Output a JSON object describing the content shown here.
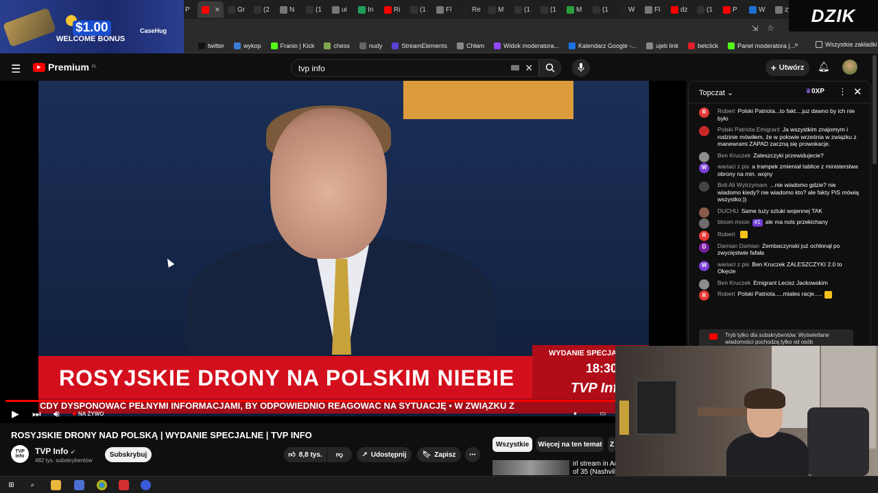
{
  "browser": {
    "tabs": [
      {
        "label": "",
        "color": "#ff0000"
      },
      {
        "label": "La",
        "color": "#ff0000"
      },
      {
        "label": "",
        "color": "#ff0000"
      },
      {
        "label": "",
        "color": "#ff0000"
      },
      {
        "label": "P",
        "color": "#ff0000"
      },
      {
        "label": "(3",
        "color": "#111111"
      },
      {
        "label": "P",
        "color": "#ff0000"
      },
      {
        "label": "",
        "color": "#ff0000"
      },
      {
        "label": "Gr",
        "color": "#333333"
      },
      {
        "label": "(2",
        "color": "#333333"
      },
      {
        "label": "N",
        "color": "#777777"
      },
      {
        "label": "(1",
        "color": "#333333"
      },
      {
        "label": "ui",
        "color": "#777777"
      },
      {
        "label": "In",
        "color": "#1e9e5a"
      },
      {
        "label": "Ri",
        "color": "#ff0000"
      },
      {
        "label": "(1",
        "color": "#333333"
      },
      {
        "label": "Fl",
        "color": "#777777"
      },
      {
        "label": "Re",
        "color": "#222222"
      },
      {
        "label": "M",
        "color": "#333333"
      },
      {
        "label": "(1",
        "color": "#333333"
      },
      {
        "label": "(1",
        "color": "#333333"
      },
      {
        "label": "M",
        "color": "#2e9e3e"
      },
      {
        "label": "(1",
        "color": "#333333"
      },
      {
        "label": "W",
        "color": "#222222"
      },
      {
        "label": "Fl",
        "color": "#777777"
      },
      {
        "label": "dz",
        "color": "#ff0000"
      },
      {
        "label": "(1",
        "color": "#333333"
      },
      {
        "label": "P",
        "color": "#ff0000"
      },
      {
        "label": "W",
        "color": "#1e6fd0"
      },
      {
        "label": "zy",
        "color": "#777777"
      }
    ],
    "new_tab": "+",
    "bookmarks": [
      {
        "label": "twitter",
        "color": "#111111"
      },
      {
        "label": "wykop",
        "color": "#3a7bd5"
      },
      {
        "label": "Franio | Kick",
        "color": "#53fc18"
      },
      {
        "label": "chess",
        "color": "#7fa650"
      },
      {
        "label": "nudy",
        "color": "#666666"
      },
      {
        "label": "StreamElements",
        "color": "#5b3fd6"
      },
      {
        "label": "Chłam",
        "color": "#888888"
      },
      {
        "label": "Widok moderatora...",
        "color": "#9146ff"
      },
      {
        "label": "Kalendarz Google -...",
        "color": "#1a73e8"
      },
      {
        "label": "ujeb link",
        "color": "#888888"
      },
      {
        "label": "betclick",
        "color": "#e11d2a"
      },
      {
        "label": "Panel moderatora |...",
        "color": "#53fc18"
      }
    ],
    "all_bookmarks": "Wszystkie zakładki"
  },
  "promo": {
    "amount": "$1.00",
    "text": "WELCOME BONUS",
    "brand": "CaseHug"
  },
  "overlay_logo": "DZIK",
  "youtube": {
    "logo": "Premium",
    "logo_region": "PL",
    "search_value": "tvp info",
    "create_label": "Utwórz"
  },
  "video": {
    "lower_third": "ROSYJSKIE DRONY NA POLSKIM NIEBIE",
    "edition": "WYDANIE SPECJALNE",
    "time": "18:30",
    "channel_mark": "TVP Info",
    "ticker": "CDY DYSPONOWAĆ PEŁNYMI INFORMACJAMI, BY ODPOWIEDNIO REAGOWAĆ NA SYTUACJĘ  •  W ZWIĄZKU Z",
    "live_label": "NA ŻYWO",
    "progress": 1.0
  },
  "meta": {
    "title": "ROSYJSKIE DRONY NAD POLSKĄ | WYDANIE SPECJALNE | TVP INFO",
    "channel": "TVP Info",
    "channel_logo": "TVP Info",
    "subs": "482 tys. subskrybentów",
    "subscribe": "Subskrybuj",
    "likes": "8,8 tys.",
    "share": "Udostępnij",
    "save": "Zapisz"
  },
  "chips": {
    "all": "Wszystkie",
    "more": "Więcej na ten temat",
    "next": "Z"
  },
  "recommend": {
    "line1": "irl stream in Ar",
    "line2": "of 35 (Nashvill"
  },
  "chat": {
    "title": "Topczat",
    "xp": "0XP",
    "messages": [
      {
        "author": "Robert",
        "text": "Polski Patriota...to fakt....juz dawno by ich nie było",
        "initial": "R",
        "color": "#e53935"
      },
      {
        "author": "Polski Patriota Emigrant",
        "text": "Ja wszystkim znajomym i rodzinie mówiłem, że w połowie września w związku z manewrami ZAPAD zaczną się prowokacje.",
        "initial": "",
        "color": "#c62828"
      },
      {
        "author": "Ben Kruczek",
        "text": "Zaleszczyki przewidujecie?",
        "initial": "",
        "color": "#8d8d8d"
      },
      {
        "author": "wariaci z pis",
        "text": "a trampek zmieniał tablice z ministerstwa obrony na min. wojny",
        "initial": "W",
        "color": "#7b3fd6"
      },
      {
        "author": "Boli Ali Wytrzymam",
        "text": "...nie wiadomo gdzie? nie wiadomo kiedy? nie wiadomo kto? ale fakty PiS mówią wszystko:))",
        "initial": "",
        "color": "#444444"
      },
      {
        "author": "DUCHU",
        "text": "Same tuzy sztuki wojennej TAK",
        "initial": "",
        "color": "#8a5a4a"
      },
      {
        "author": "bloom moon",
        "badge": "#1",
        "text": "ale ma nols przekichany",
        "initial": "",
        "color": "#6d6d6d"
      },
      {
        "author": "Robert",
        "text": "",
        "emoji": true,
        "initial": "R",
        "color": "#e53935"
      },
      {
        "author": "Damian Damian",
        "text": "Zembaczynski już ochłonął po zwycięstwie fafała",
        "initial": "D",
        "color": "#7b1fa2"
      },
      {
        "author": "wariaci z pis",
        "text": "Ben Kruczek ZALESZCZYKI 2.0 to Okęcie",
        "initial": "W",
        "color": "#7b3fd6"
      },
      {
        "author": "Ben Kruczek",
        "text": "Emigrant Lecisz Jackowskim",
        "initial": "",
        "color": "#8d8d8d"
      },
      {
        "author": "Robert",
        "text": "Polski Patriota.....miales racje.....",
        "emoji": true,
        "initial": "R",
        "color": "#e53935"
      }
    ],
    "notice": "Tryb tylko dla subskrybentów. Wyświetlane wiadomości pochodzą tylko od osób"
  }
}
